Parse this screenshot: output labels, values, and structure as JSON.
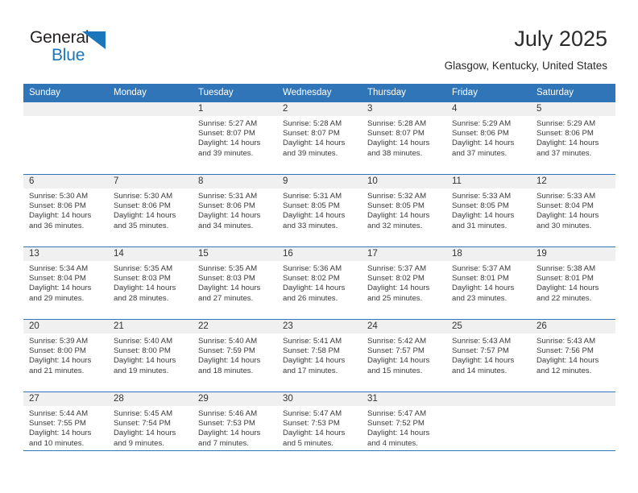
{
  "brand": {
    "name_part1": "General",
    "name_part2": "Blue",
    "triangle_color": "#1b75bb"
  },
  "header": {
    "title": "July 2025",
    "location": "Glasgow, Kentucky, United States",
    "header_bg_color": "#3075b8",
    "daynum_bg_color": "#f0f0f0"
  },
  "weekday_headers": [
    "Sunday",
    "Monday",
    "Tuesday",
    "Wednesday",
    "Thursday",
    "Friday",
    "Saturday"
  ],
  "weeks": [
    [
      {
        "day": "",
        "sunrise": "",
        "sunset": "",
        "daylight_line1": "",
        "daylight_line2": ""
      },
      {
        "day": "",
        "sunrise": "",
        "sunset": "",
        "daylight_line1": "",
        "daylight_line2": ""
      },
      {
        "day": "1",
        "sunrise": "Sunrise: 5:27 AM",
        "sunset": "Sunset: 8:07 PM",
        "daylight_line1": "Daylight: 14 hours",
        "daylight_line2": "and 39 minutes."
      },
      {
        "day": "2",
        "sunrise": "Sunrise: 5:28 AM",
        "sunset": "Sunset: 8:07 PM",
        "daylight_line1": "Daylight: 14 hours",
        "daylight_line2": "and 39 minutes."
      },
      {
        "day": "3",
        "sunrise": "Sunrise: 5:28 AM",
        "sunset": "Sunset: 8:07 PM",
        "daylight_line1": "Daylight: 14 hours",
        "daylight_line2": "and 38 minutes."
      },
      {
        "day": "4",
        "sunrise": "Sunrise: 5:29 AM",
        "sunset": "Sunset: 8:06 PM",
        "daylight_line1": "Daylight: 14 hours",
        "daylight_line2": "and 37 minutes."
      },
      {
        "day": "5",
        "sunrise": "Sunrise: 5:29 AM",
        "sunset": "Sunset: 8:06 PM",
        "daylight_line1": "Daylight: 14 hours",
        "daylight_line2": "and 37 minutes."
      }
    ],
    [
      {
        "day": "6",
        "sunrise": "Sunrise: 5:30 AM",
        "sunset": "Sunset: 8:06 PM",
        "daylight_line1": "Daylight: 14 hours",
        "daylight_line2": "and 36 minutes."
      },
      {
        "day": "7",
        "sunrise": "Sunrise: 5:30 AM",
        "sunset": "Sunset: 8:06 PM",
        "daylight_line1": "Daylight: 14 hours",
        "daylight_line2": "and 35 minutes."
      },
      {
        "day": "8",
        "sunrise": "Sunrise: 5:31 AM",
        "sunset": "Sunset: 8:06 PM",
        "daylight_line1": "Daylight: 14 hours",
        "daylight_line2": "and 34 minutes."
      },
      {
        "day": "9",
        "sunrise": "Sunrise: 5:31 AM",
        "sunset": "Sunset: 8:05 PM",
        "daylight_line1": "Daylight: 14 hours",
        "daylight_line2": "and 33 minutes."
      },
      {
        "day": "10",
        "sunrise": "Sunrise: 5:32 AM",
        "sunset": "Sunset: 8:05 PM",
        "daylight_line1": "Daylight: 14 hours",
        "daylight_line2": "and 32 minutes."
      },
      {
        "day": "11",
        "sunrise": "Sunrise: 5:33 AM",
        "sunset": "Sunset: 8:05 PM",
        "daylight_line1": "Daylight: 14 hours",
        "daylight_line2": "and 31 minutes."
      },
      {
        "day": "12",
        "sunrise": "Sunrise: 5:33 AM",
        "sunset": "Sunset: 8:04 PM",
        "daylight_line1": "Daylight: 14 hours",
        "daylight_line2": "and 30 minutes."
      }
    ],
    [
      {
        "day": "13",
        "sunrise": "Sunrise: 5:34 AM",
        "sunset": "Sunset: 8:04 PM",
        "daylight_line1": "Daylight: 14 hours",
        "daylight_line2": "and 29 minutes."
      },
      {
        "day": "14",
        "sunrise": "Sunrise: 5:35 AM",
        "sunset": "Sunset: 8:03 PM",
        "daylight_line1": "Daylight: 14 hours",
        "daylight_line2": "and 28 minutes."
      },
      {
        "day": "15",
        "sunrise": "Sunrise: 5:35 AM",
        "sunset": "Sunset: 8:03 PM",
        "daylight_line1": "Daylight: 14 hours",
        "daylight_line2": "and 27 minutes."
      },
      {
        "day": "16",
        "sunrise": "Sunrise: 5:36 AM",
        "sunset": "Sunset: 8:02 PM",
        "daylight_line1": "Daylight: 14 hours",
        "daylight_line2": "and 26 minutes."
      },
      {
        "day": "17",
        "sunrise": "Sunrise: 5:37 AM",
        "sunset": "Sunset: 8:02 PM",
        "daylight_line1": "Daylight: 14 hours",
        "daylight_line2": "and 25 minutes."
      },
      {
        "day": "18",
        "sunrise": "Sunrise: 5:37 AM",
        "sunset": "Sunset: 8:01 PM",
        "daylight_line1": "Daylight: 14 hours",
        "daylight_line2": "and 23 minutes."
      },
      {
        "day": "19",
        "sunrise": "Sunrise: 5:38 AM",
        "sunset": "Sunset: 8:01 PM",
        "daylight_line1": "Daylight: 14 hours",
        "daylight_line2": "and 22 minutes."
      }
    ],
    [
      {
        "day": "20",
        "sunrise": "Sunrise: 5:39 AM",
        "sunset": "Sunset: 8:00 PM",
        "daylight_line1": "Daylight: 14 hours",
        "daylight_line2": "and 21 minutes."
      },
      {
        "day": "21",
        "sunrise": "Sunrise: 5:40 AM",
        "sunset": "Sunset: 8:00 PM",
        "daylight_line1": "Daylight: 14 hours",
        "daylight_line2": "and 19 minutes."
      },
      {
        "day": "22",
        "sunrise": "Sunrise: 5:40 AM",
        "sunset": "Sunset: 7:59 PM",
        "daylight_line1": "Daylight: 14 hours",
        "daylight_line2": "and 18 minutes."
      },
      {
        "day": "23",
        "sunrise": "Sunrise: 5:41 AM",
        "sunset": "Sunset: 7:58 PM",
        "daylight_line1": "Daylight: 14 hours",
        "daylight_line2": "and 17 minutes."
      },
      {
        "day": "24",
        "sunrise": "Sunrise: 5:42 AM",
        "sunset": "Sunset: 7:57 PM",
        "daylight_line1": "Daylight: 14 hours",
        "daylight_line2": "and 15 minutes."
      },
      {
        "day": "25",
        "sunrise": "Sunrise: 5:43 AM",
        "sunset": "Sunset: 7:57 PM",
        "daylight_line1": "Daylight: 14 hours",
        "daylight_line2": "and 14 minutes."
      },
      {
        "day": "26",
        "sunrise": "Sunrise: 5:43 AM",
        "sunset": "Sunset: 7:56 PM",
        "daylight_line1": "Daylight: 14 hours",
        "daylight_line2": "and 12 minutes."
      }
    ],
    [
      {
        "day": "27",
        "sunrise": "Sunrise: 5:44 AM",
        "sunset": "Sunset: 7:55 PM",
        "daylight_line1": "Daylight: 14 hours",
        "daylight_line2": "and 10 minutes."
      },
      {
        "day": "28",
        "sunrise": "Sunrise: 5:45 AM",
        "sunset": "Sunset: 7:54 PM",
        "daylight_line1": "Daylight: 14 hours",
        "daylight_line2": "and 9 minutes."
      },
      {
        "day": "29",
        "sunrise": "Sunrise: 5:46 AM",
        "sunset": "Sunset: 7:53 PM",
        "daylight_line1": "Daylight: 14 hours",
        "daylight_line2": "and 7 minutes."
      },
      {
        "day": "30",
        "sunrise": "Sunrise: 5:47 AM",
        "sunset": "Sunset: 7:53 PM",
        "daylight_line1": "Daylight: 14 hours",
        "daylight_line2": "and 5 minutes."
      },
      {
        "day": "31",
        "sunrise": "Sunrise: 5:47 AM",
        "sunset": "Sunset: 7:52 PM",
        "daylight_line1": "Daylight: 14 hours",
        "daylight_line2": "and 4 minutes."
      },
      {
        "day": "",
        "sunrise": "",
        "sunset": "",
        "daylight_line1": "",
        "daylight_line2": ""
      },
      {
        "day": "",
        "sunrise": "",
        "sunset": "",
        "daylight_line1": "",
        "daylight_line2": ""
      }
    ]
  ]
}
